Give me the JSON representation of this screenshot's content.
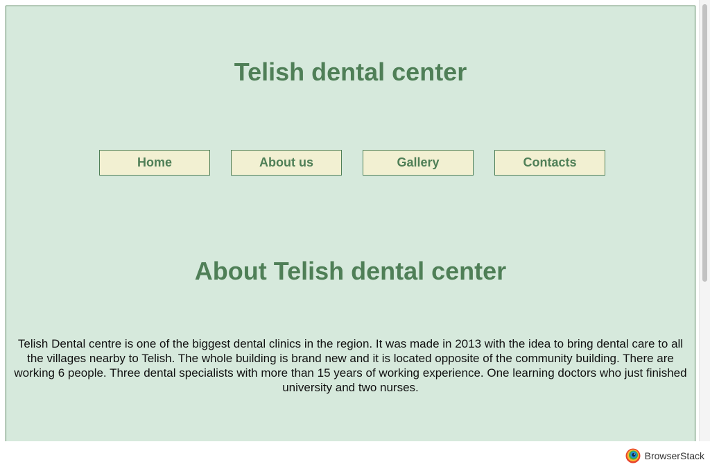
{
  "site": {
    "title": "Telish dental center"
  },
  "nav": {
    "items": [
      {
        "label": "Home"
      },
      {
        "label": "About us"
      },
      {
        "label": "Gallery"
      },
      {
        "label": "Contacts"
      }
    ]
  },
  "about": {
    "heading": "About Telish dental center",
    "text": "Telish Dental centre is one of the biggest dental clinics in the region. It was made in 2013 with the idea to bring dental care to all the villages nearby to Telish. The whole building is brand new and it is located opposite of the community building. There are working 6 people. Three dental specialists with more than 15 years of working experience. One learning doctors who just finished university and two nurses."
  },
  "footer": {
    "brand_prefix": "Browser",
    "brand_suffix": "Stack",
    "logo_icon": "browserstack-logo-icon"
  },
  "colors": {
    "page_background": "#d6e9dc",
    "accent_green": "#4f7f57",
    "nav_button_background": "#f2f0d2",
    "body_text": "#111111"
  }
}
